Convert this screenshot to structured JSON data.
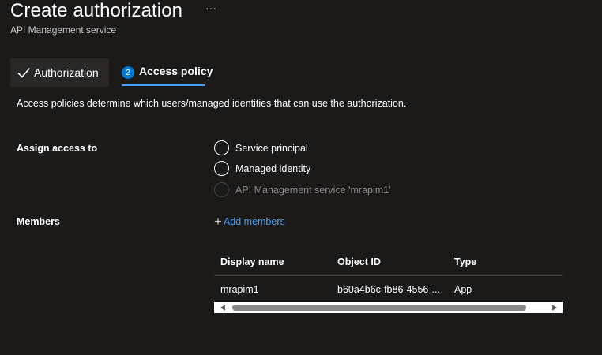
{
  "header": {
    "title": "Create authorization",
    "subtitle": "API Management service",
    "more_label": "···"
  },
  "tabs": [
    {
      "label": "Authorization",
      "state": "completed",
      "icon": "checkmark-icon"
    },
    {
      "label": "Access policy",
      "state": "active",
      "step": "2"
    }
  ],
  "description": "Access policies determine which users/managed identities that can use the authorization.",
  "assign": {
    "label": "Assign access to",
    "options": [
      {
        "label": "Service principal",
        "disabled": false
      },
      {
        "label": "Managed identity",
        "disabled": false
      },
      {
        "label": "API Management service 'mrapim1'",
        "disabled": true
      }
    ]
  },
  "members": {
    "label": "Members",
    "add_label": "Add members",
    "columns": [
      "Display name",
      "Object ID",
      "Type"
    ],
    "rows": [
      {
        "display_name": "mrapim1",
        "object_id": "b60a4b6c-fb86-4556-...",
        "type": "App"
      }
    ]
  },
  "colors": {
    "background": "#1b1a19",
    "accent": "#479ef5",
    "step_badge": "#0078d4"
  }
}
